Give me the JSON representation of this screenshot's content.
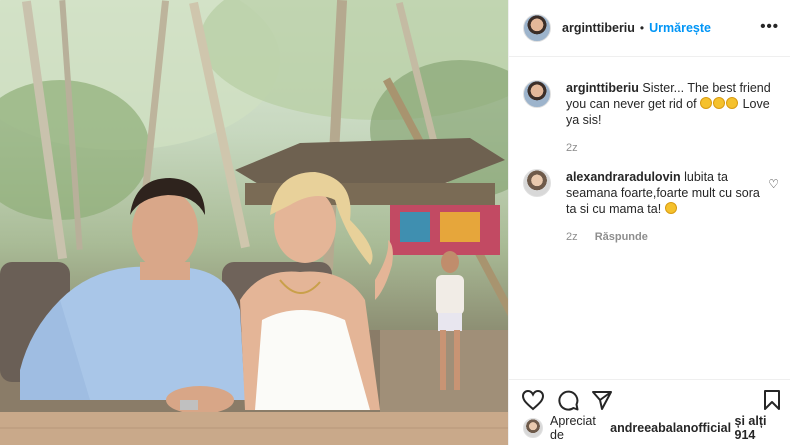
{
  "header": {
    "username": "arginttiberiu",
    "separator": "•",
    "follow_label": "Urmărește",
    "more_label": "•••"
  },
  "caption": {
    "username": "arginttiberiu",
    "text": "Sister... The best friend you can never get rid of",
    "text2": "Love ya sis!",
    "time": "2z"
  },
  "comment": {
    "username": "alexandraradulovin",
    "text": "lubita ta seamana foarte,foarte mult cu sora ta si cu mama ta!",
    "time": "2z",
    "reply_label": "Răspunde"
  },
  "liked_by": {
    "prefix": "Apreciat de",
    "user": "andreeabalanofficial",
    "suffix": "și alți 914"
  },
  "colors": {
    "accent": "#0095f6",
    "muted": "#8e8e8e",
    "text": "#262626",
    "border": "#efefef"
  },
  "icons": [
    "heart-icon",
    "comment-icon",
    "share-icon",
    "bookmark-icon",
    "more-icon"
  ]
}
